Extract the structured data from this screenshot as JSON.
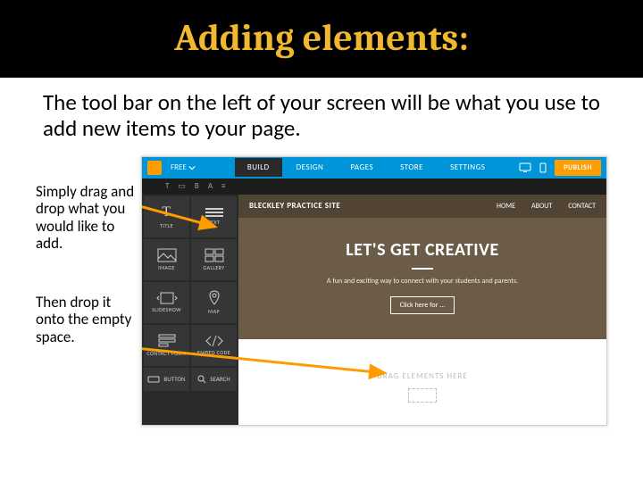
{
  "title": "Adding elements:",
  "body_text": "The tool bar on the left of your screen will be what you use to add new items to your page.",
  "side": {
    "p1": "Simply drag and drop what you would like to add.",
    "p2": "Then drop it onto the empty space."
  },
  "editor": {
    "free_label": "FREE",
    "tabs": [
      "BUILD",
      "DESIGN",
      "PAGES",
      "STORE",
      "SETTINGS"
    ],
    "active_tab": 0,
    "publish_label": "PUBLISH"
  },
  "palette": {
    "items": [
      {
        "label": "TITLE",
        "glyph": "T"
      },
      {
        "label": "TEXT",
        "glyph": "lines"
      },
      {
        "label": "IMAGE",
        "glyph": "image"
      },
      {
        "label": "GALLERY",
        "glyph": "gallery"
      },
      {
        "label": "SLIDESHOW",
        "glyph": "slideshow"
      },
      {
        "label": "MAP",
        "glyph": "map"
      },
      {
        "label": "CONTACT FORM",
        "glyph": "form"
      },
      {
        "label": "EMBED CODE",
        "glyph": "code"
      }
    ],
    "footer": [
      {
        "label": "BUTTON"
      },
      {
        "label": "SEARCH"
      }
    ]
  },
  "site": {
    "title": "BLECKLEY PRACTICE SITE",
    "nav": [
      "HOME",
      "ABOUT",
      "CONTACT"
    ],
    "hero_heading": "LET'S GET CREATIVE",
    "hero_sub": "A fun and exciting way to connect with your students and parents.",
    "cta": "Click here for ...",
    "drop_hint": "DRAG ELEMENTS HERE"
  }
}
